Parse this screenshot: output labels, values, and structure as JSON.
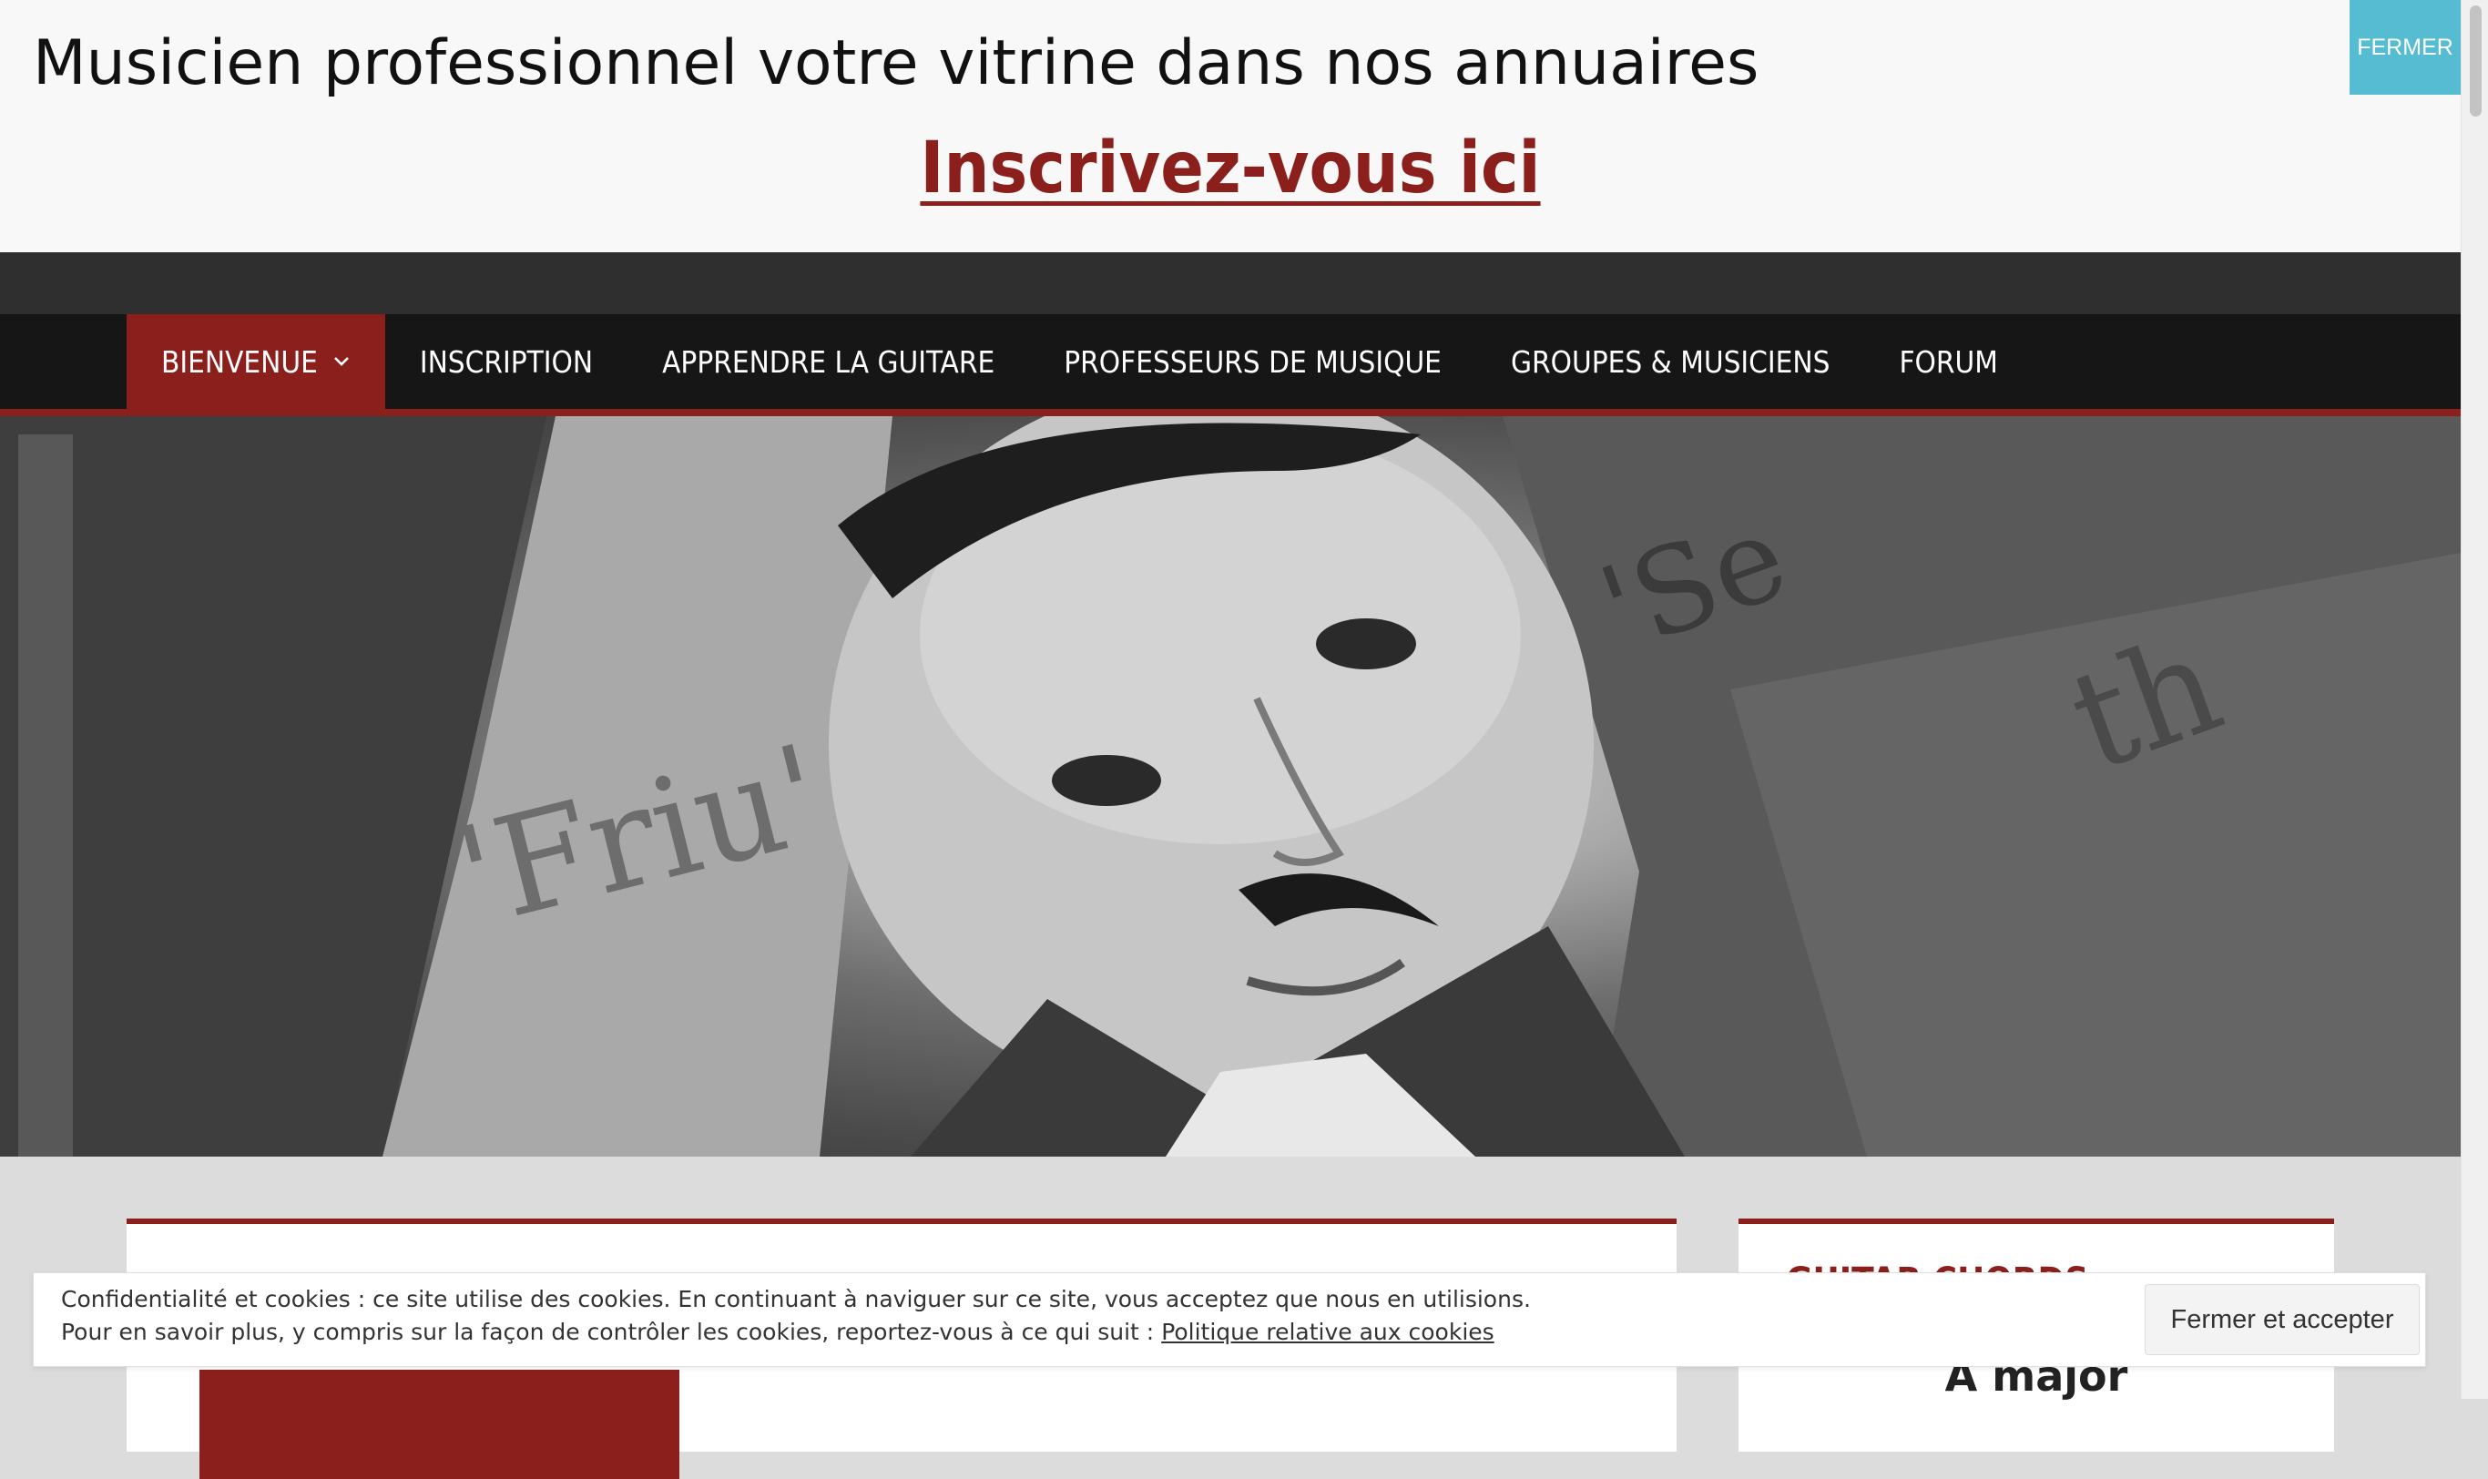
{
  "promo": {
    "title": "Musicien professionnel votre vitrine dans nos annuaires",
    "cta": "Inscrivez-vous ici",
    "close_label": "FERMER"
  },
  "nav": {
    "items": [
      {
        "label": "BIENVENUE",
        "active": true,
        "has_dropdown": true
      },
      {
        "label": "INSCRIPTION"
      },
      {
        "label": "APPRENDRE LA GUITARE"
      },
      {
        "label": "PROFESSEURS DE MUSIQUE"
      },
      {
        "label": "GROUPES & MUSICIENS"
      },
      {
        "label": "FORUM"
      }
    ]
  },
  "hero": {
    "icon": "guitarist-portrait-photo"
  },
  "sidebar": {
    "widget_title": "GUITAR CHORDS",
    "widget_subtitle": "A major"
  },
  "cookie": {
    "line1": "Confidentialité et cookies : ce site utilise des cookies. En continuant à naviguer sur ce site, vous acceptez que nous en utilisions.",
    "line2_prefix": "Pour en savoir plus, y compris sur la façon de contrôler les cookies, reportez-vous à ce qui suit : ",
    "link": "Politique relative aux cookies",
    "accept_label": "Fermer et accepter"
  },
  "colors": {
    "accent": "#8b1f1c",
    "close_button": "#55bcd2",
    "nav_bg": "#161616",
    "topbar_bg": "#2f2f2f"
  }
}
